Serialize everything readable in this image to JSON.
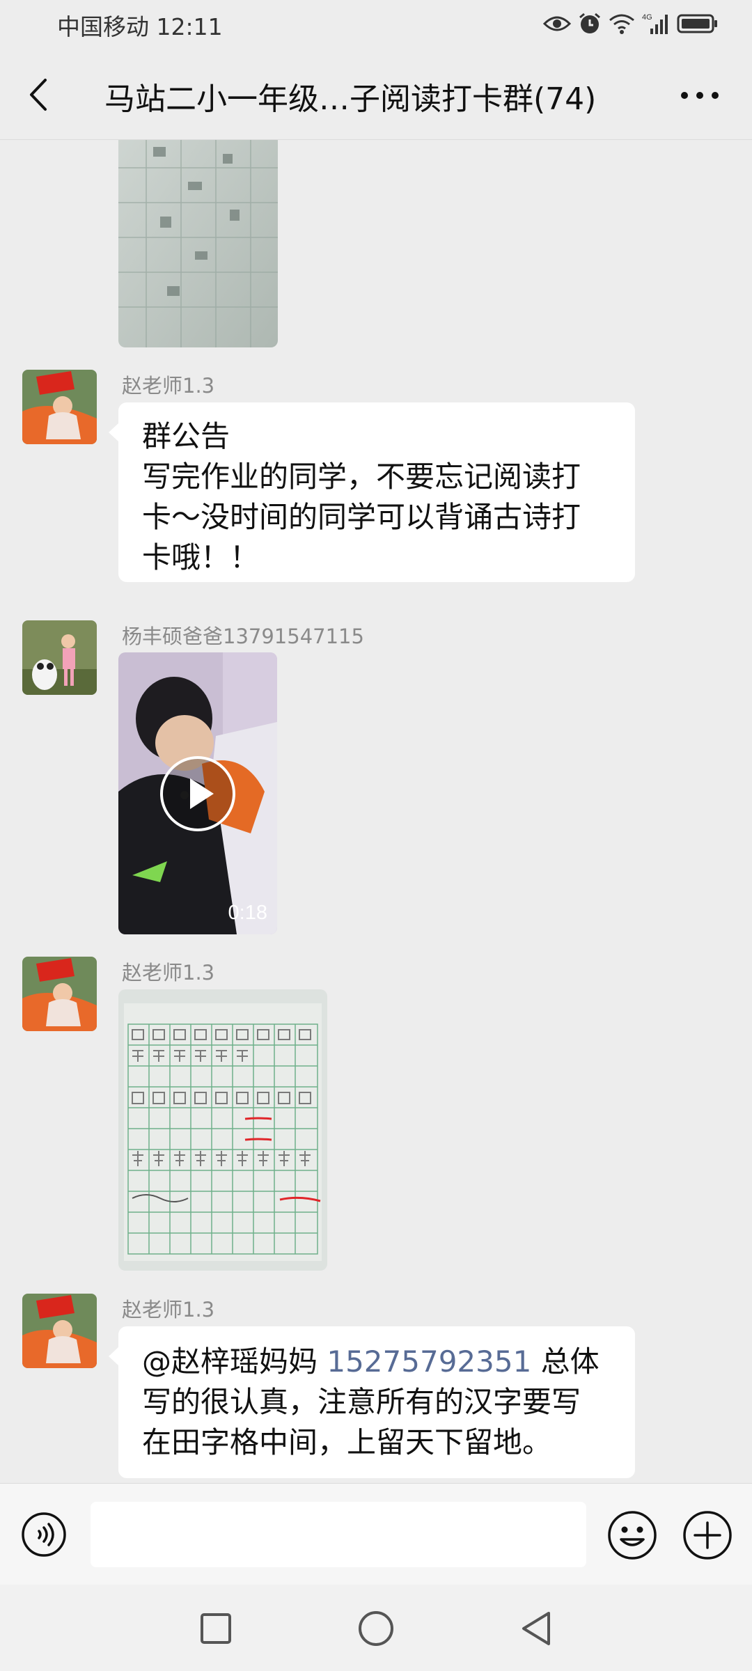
{
  "status_bar": {
    "carrier_time": "中国移动 12:11",
    "network": "4G"
  },
  "header": {
    "title": "马站二小一年级…子阅读打卡群(74)"
  },
  "messages": [
    {
      "type": "image",
      "content": "worksheet photo (partially visible)"
    },
    {
      "type": "text",
      "sender": "赵老师1.3",
      "lines": [
        "群公告",
        "写完作业的同学，不要忘记阅读打",
        "卡～没时间的同学可以背诵古诗打",
        "卡哦！！"
      ]
    },
    {
      "type": "video",
      "sender": "杨丰硕爸爸13791547115",
      "duration": "0:18"
    },
    {
      "type": "image",
      "sender": "赵老师1.3",
      "content": "handwriting practice sheet"
    },
    {
      "type": "text",
      "sender": "赵老师1.3",
      "mention": "@赵梓瑶妈妈 ",
      "phone": "15275792351",
      "after_phone": " 总体",
      "lines": [
        "写的很认真，注意所有的汉字要写",
        "在田字格中间，上留天下留地。"
      ]
    }
  ],
  "input_bar": {
    "placeholder": ""
  },
  "colors": {
    "background": "#ededed",
    "bubble": "#ffffff",
    "link": "#576b95",
    "sender_name": "#8a8a8a"
  },
  "icons": {
    "back": "chevron-left-icon",
    "more": "more-dots-icon",
    "voice": "voice-icon",
    "emoji": "emoji-icon",
    "plus": "plus-icon",
    "play": "play-icon"
  }
}
